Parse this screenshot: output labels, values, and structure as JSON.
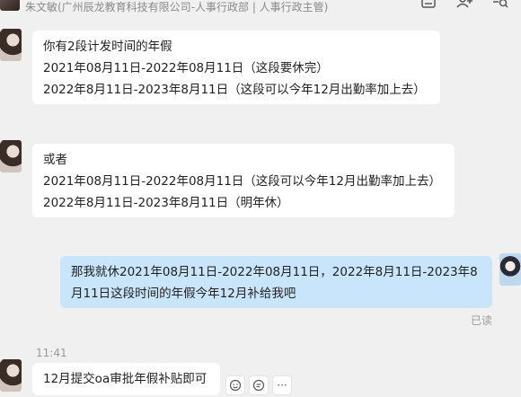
{
  "header": {
    "subtitle": "朱文敏(广州辰龙教育科技有限公司-人事行政部 | 人事行政主管)"
  },
  "messages": [
    {
      "lines": [
        "你有2段计发时间的年假",
        "2021年08月11日-2022年08月11日（这段要休完）",
        "2022年8月11日-2023年8月11日（这段可以今年12月出勤率加上去）"
      ]
    },
    {
      "lines": [
        "或者",
        "2021年08月11日-2022年08月11日（这段可以今年12月出勤率加上去）",
        "2022年8月11日-2023年8月11日（明年休）"
      ]
    },
    {
      "text": "那我就休2021年08月11日-2022年08月11日，2022年8月11日-2023年8月11日这段时间的年假今年12月补给我吧",
      "status": "已读"
    },
    {
      "time": "11:41",
      "text": "12月提交oa审批年假补贴即可"
    }
  ],
  "icons": {
    "header_tools": [
      "note-icon",
      "add-member-icon",
      "search-history-icon"
    ],
    "message_actions": [
      "add-reaction-icon",
      "reply-icon",
      "more-icon"
    ]
  },
  "more_glyph": "···"
}
